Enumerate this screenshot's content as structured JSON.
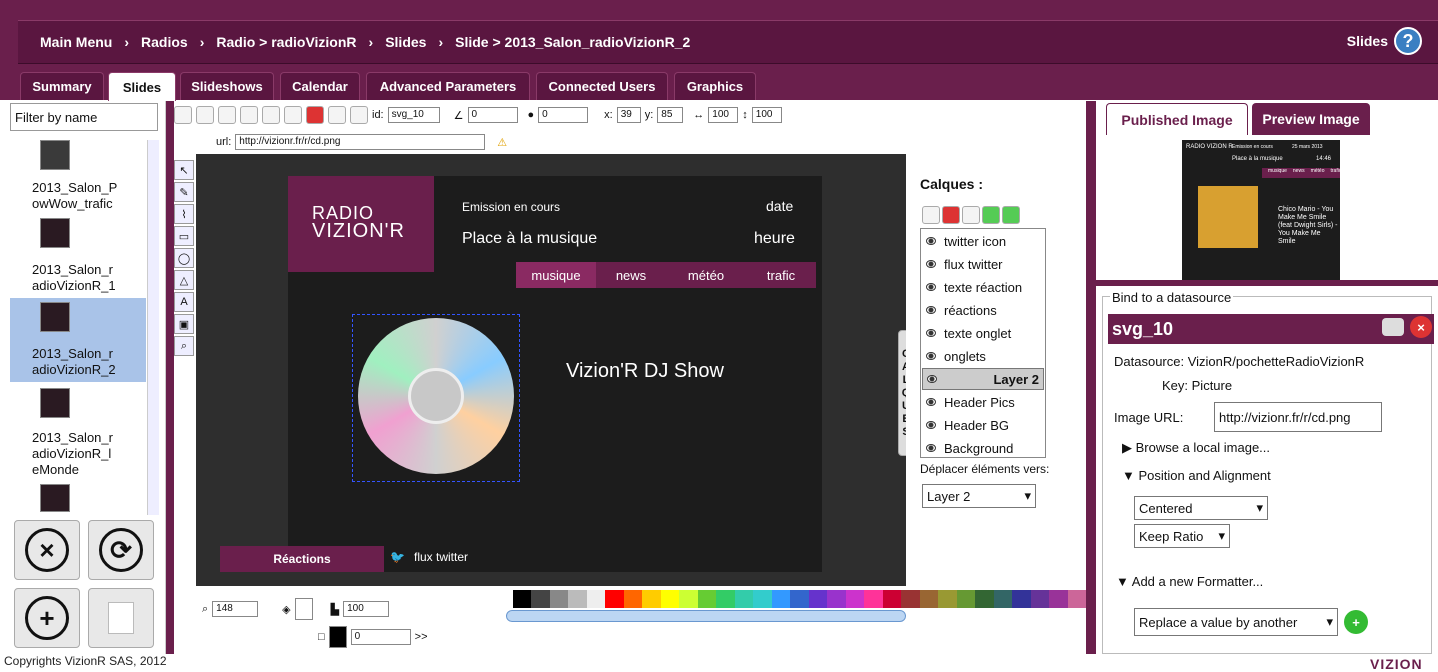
{
  "breadcrumb": {
    "items": [
      "Main Menu",
      "Radios",
      "Radio > radioVizionR",
      "Slides",
      "Slide > 2013_Salon_radioVizionR_2"
    ],
    "right_label": "Slides"
  },
  "tabs": [
    "Summary",
    "Slides",
    "Slideshows",
    "Calendar",
    "Advanced Parameters",
    "Connected Users",
    "Graphics"
  ],
  "active_tab": "Slides",
  "sidebar": {
    "filter_placeholder": "Filter by name",
    "items": [
      "2013_Salon_PowWow_trafic",
      "2013_Salon_radioVizionR_1",
      "2013_Salon_radioVizionR_2",
      "2013_Salon_radioVizionR_lM eMonde"
    ],
    "item_lines": [
      [
        "2013_Salon_P",
        "owWow_trafic"
      ],
      [
        "2013_Salon_r",
        "adioVizionR_1"
      ],
      [
        "2013_Salon_r",
        "adioVizionR_2"
      ],
      [
        "2013_Salon_r",
        "adioVizionR_l",
        "eMonde"
      ]
    ]
  },
  "toolbar": {
    "id_label": "id:",
    "id_value": "svg_10",
    "angle": "0",
    "opacity": "0",
    "x_label": "x:",
    "x_value": "39",
    "y_label": "y:",
    "y_value": "85",
    "w_value": "100",
    "h_value": "100",
    "url_label": "url:",
    "url_value": "http://vizionr.fr/r/cd.png"
  },
  "slide": {
    "logo_line1": "RADIO",
    "logo_line2": "VIZION'R",
    "emission": "Emission en cours",
    "date": "date",
    "title": "Place à la musique",
    "heure": "heure",
    "nav": [
      "musique",
      "news",
      "météo",
      "trafic"
    ],
    "show": "Vizion'R DJ Show",
    "reactions": "Réactions",
    "flux": "flux twitter"
  },
  "calques": {
    "title": "Calques :",
    "layers": [
      "twitter icon",
      "flux twitter",
      "texte réaction",
      "réactions",
      "texte onglet",
      "onglets",
      "Layer 2",
      "Header Pics",
      "Header BG",
      "Background"
    ],
    "selected": "Layer 2",
    "move_label": "Déplacer éléments vers:",
    "move_value": "Layer 2",
    "side_tab": [
      "C",
      "A",
      "L",
      "Q",
      "U",
      "E",
      "S"
    ]
  },
  "bottom": {
    "zoom": "148",
    "opacity2": "100",
    "stroke": "0",
    "more": ">>"
  },
  "palette": [
    "#ffffff",
    "#000000",
    "#444444",
    "#888888",
    "#bbbbbb",
    "#eeeeee",
    "#ff0000",
    "#ff6600",
    "#ffcc00",
    "#ffff00",
    "#ccff33",
    "#66cc33",
    "#33cc66",
    "#33ccaa",
    "#33cccc",
    "#3399ff",
    "#3366cc",
    "#6633cc",
    "#9933cc",
    "#cc33cc",
    "#ff3399",
    "#cc0033",
    "#993333",
    "#996633",
    "#999933",
    "#669933",
    "#336633",
    "#336666",
    "#333399",
    "#663399",
    "#993399",
    "#cc6699"
  ],
  "right": {
    "tabs": [
      "Published Image",
      "Preview Image"
    ],
    "preview": {
      "station": "RADIO VIZION R",
      "emission": "Emission en cours",
      "date": "25 mars 2013",
      "title": "Place à la musique",
      "time": "14:46",
      "nav": [
        "musique",
        "news",
        "météo",
        "trafic"
      ],
      "song": "Chico Mario - You Make Me Smile (feat Dwight Sirls) - You Make Me Smile"
    },
    "bind_label": "Bind to a datasource",
    "element_id": "svg_10",
    "datasource_label": "Datasource:",
    "datasource": "VizionR/pochetteRadioVizionR",
    "key_label": "Key:",
    "key": "Picture",
    "image_url_label": "Image URL:",
    "image_url": "http://vizionr.fr/r/cd.png",
    "browse": "Browse a local image...",
    "position": "Position and Alignment",
    "align": "Centered",
    "ratio": "Keep Ratio",
    "formatter": "Add a new Formatter...",
    "formatter_select": "Replace a value by another"
  },
  "footer": {
    "copyright": "Copyrights VizionR SAS, 2012",
    "brand": "VIZION"
  }
}
